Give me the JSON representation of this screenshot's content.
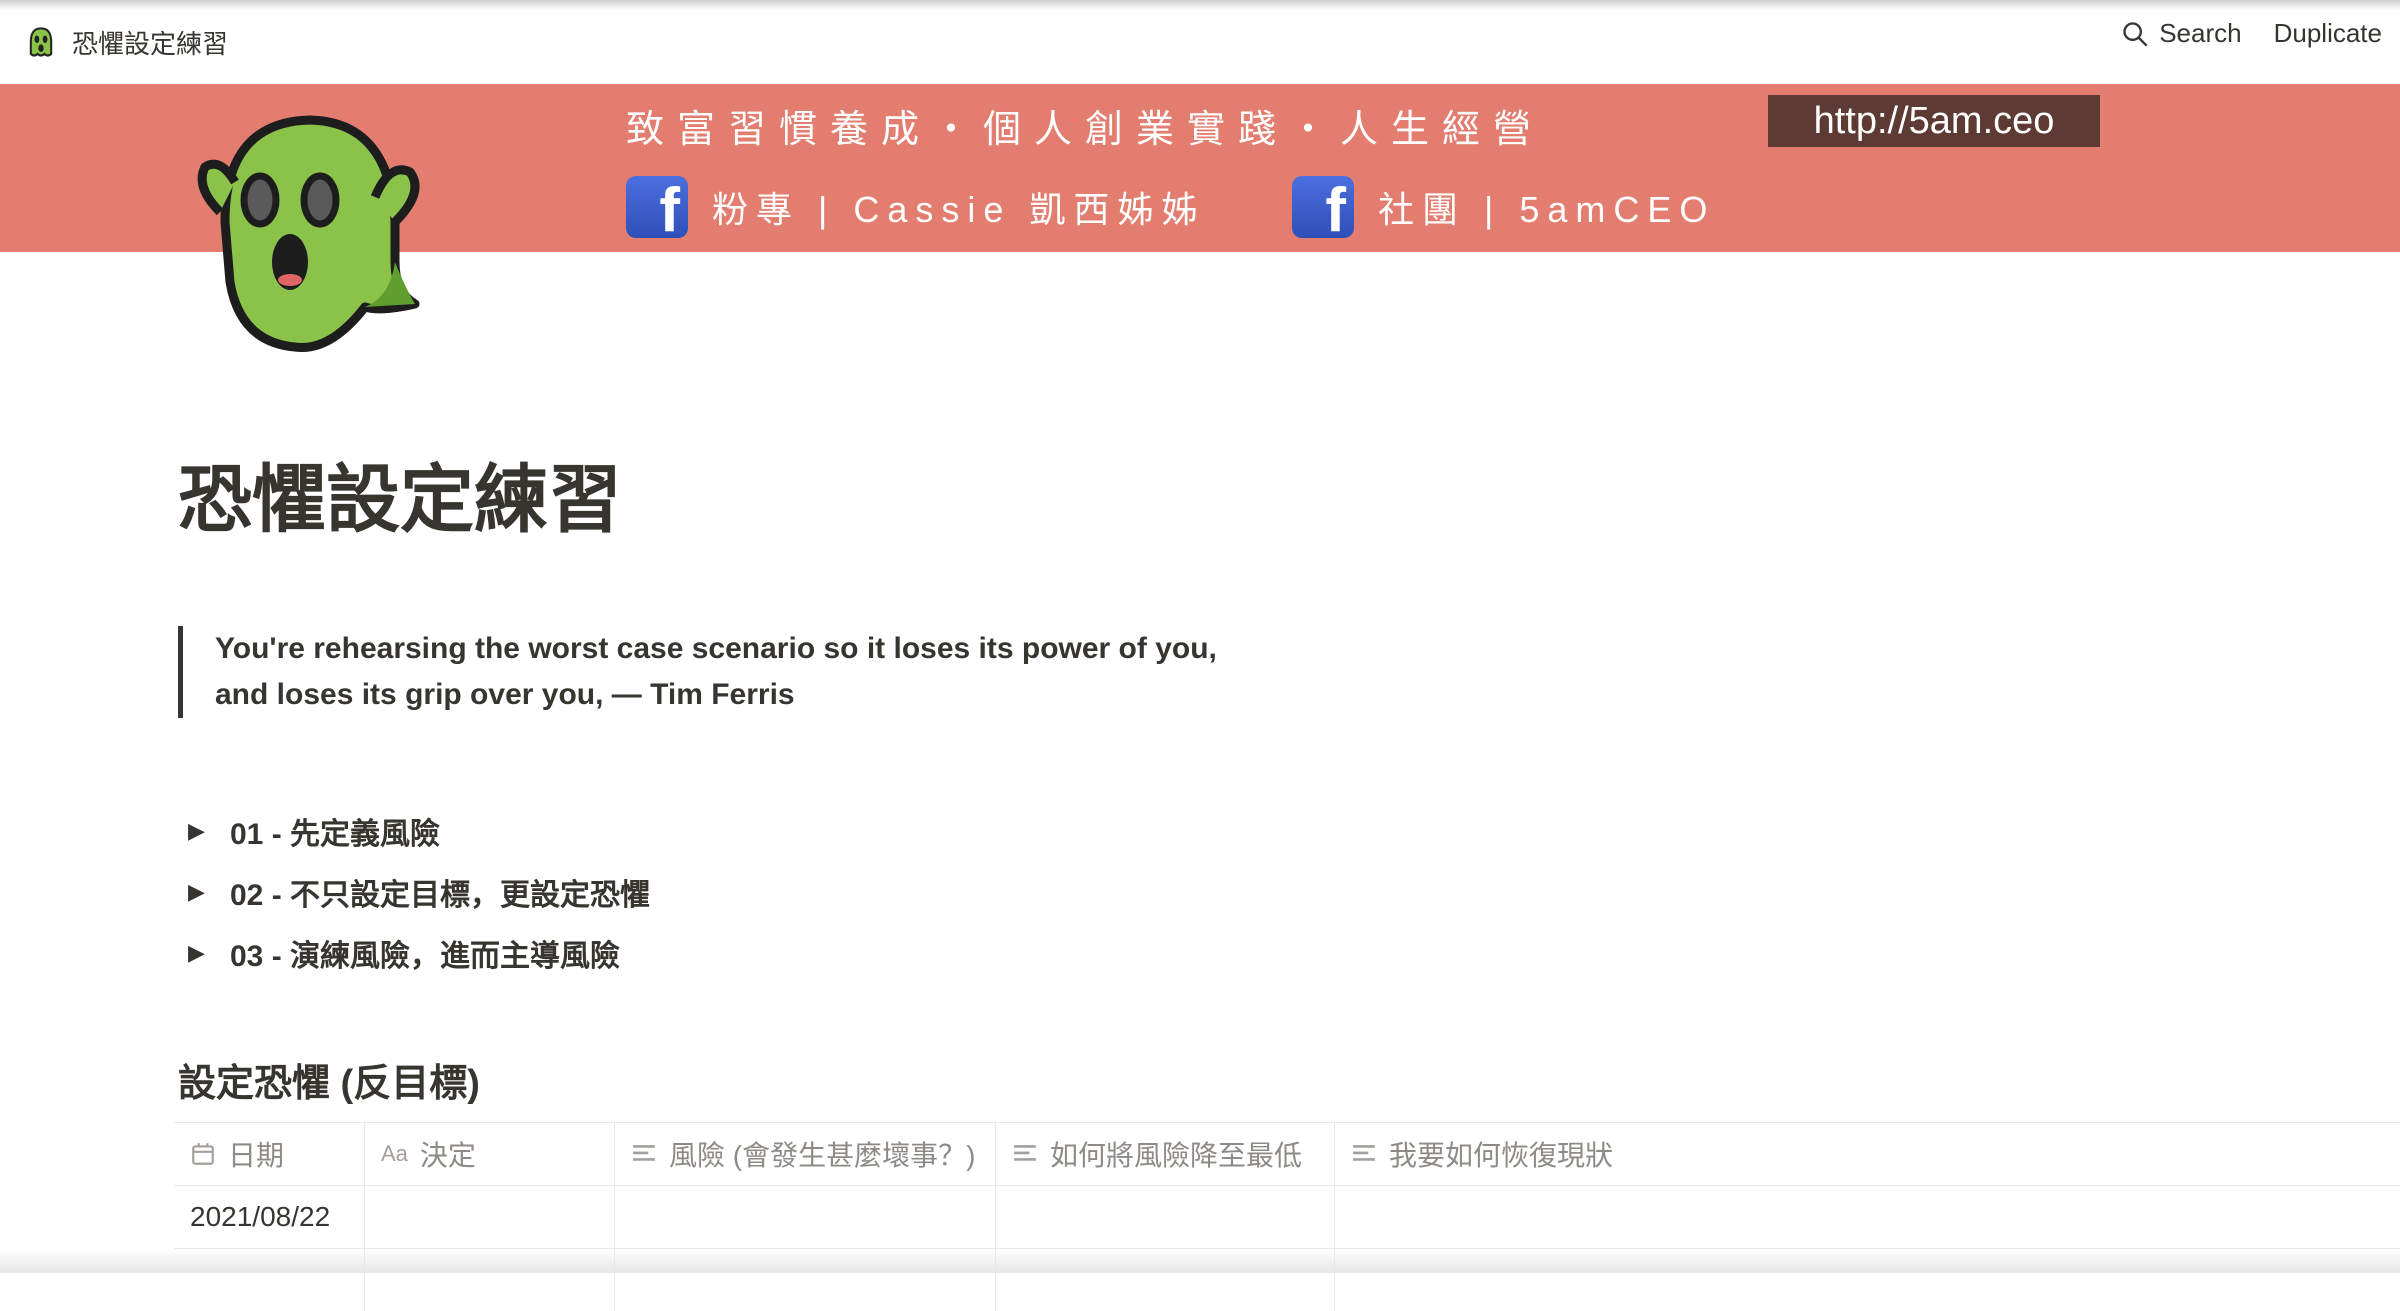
{
  "topbar": {
    "page_title": "恐懼設定練習",
    "page_icon": "ghost-icon",
    "search_label": "Search",
    "duplicate_label": "Duplicate"
  },
  "cover": {
    "background_color": "#e27d6f",
    "line1": "致富習慣養成・個人創業實踐・人生經營",
    "url": "http://5am.ceo",
    "fb_links": [
      {
        "icon": "facebook-icon",
        "label": "粉專 | Cassie 凱西姊姊"
      },
      {
        "icon": "facebook-icon",
        "label": "社團 | 5amCEO"
      }
    ]
  },
  "page": {
    "title": "恐懼設定練習",
    "quote_line1": "You're rehearsing the worst case scenario so it loses its power of you,",
    "quote_line2": "and loses its grip over you, — Tim Ferris",
    "toggles": [
      {
        "label": "01 - 先定義風險"
      },
      {
        "label": "02 - 不只設定目標，更設定恐懼"
      },
      {
        "label": "03 - 演練風險，進而主導風險"
      }
    ],
    "section_heading": "設定恐懼 (反目標)"
  },
  "table": {
    "columns": [
      {
        "icon": "calendar-icon",
        "label": "日期"
      },
      {
        "icon": "title-aa-icon",
        "label": "決定"
      },
      {
        "icon": "text-lines-icon",
        "label": "風險 (會發生甚麼壞事？)"
      },
      {
        "icon": "text-lines-icon",
        "label": "如何將風險降至最低"
      },
      {
        "icon": "text-lines-icon",
        "label": "我要如何恢復現狀"
      }
    ],
    "rows": [
      [
        "2021/08/22",
        "",
        "",
        "",
        ""
      ]
    ]
  }
}
